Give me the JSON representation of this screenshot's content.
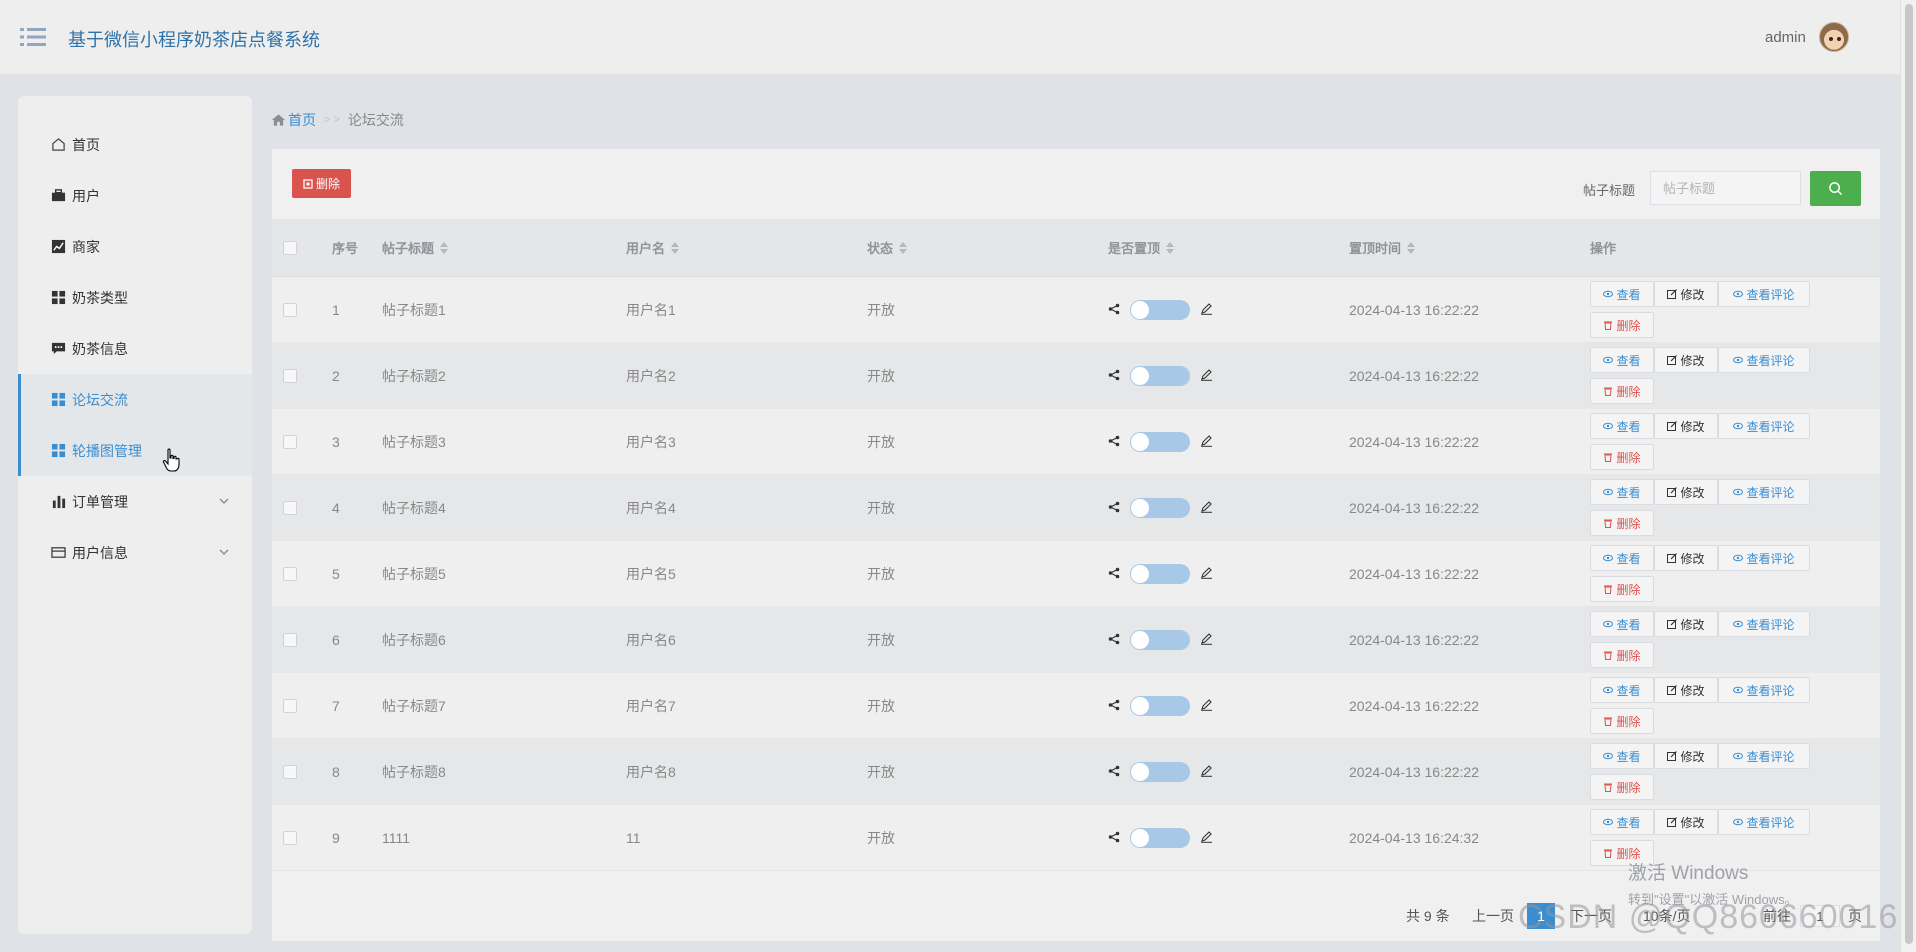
{
  "header": {
    "app_title": "基于微信小程序奶茶店点餐系统",
    "username": "admin"
  },
  "sidebar": {
    "items": [
      {
        "label": "首页",
        "icon": "home-icon"
      },
      {
        "label": "用户",
        "icon": "briefcase-icon"
      },
      {
        "label": "商家",
        "icon": "chart-line-icon"
      },
      {
        "label": "奶茶类型",
        "icon": "grid-icon"
      },
      {
        "label": "奶茶信息",
        "icon": "chat-icon"
      },
      {
        "label": "论坛交流",
        "icon": "grid-icon",
        "active": true
      },
      {
        "label": "轮播图管理",
        "icon": "grid-icon",
        "active": true
      },
      {
        "label": "订单管理",
        "icon": "bar-chart-icon",
        "expandable": true
      },
      {
        "label": "用户信息",
        "icon": "card-icon",
        "expandable": true
      }
    ]
  },
  "breadcrumb": {
    "home": "首页",
    "separator": "> >",
    "current": "论坛交流"
  },
  "toolbar": {
    "delete_label": "删除",
    "search_label": "帖子标题",
    "search_placeholder": "帖子标题"
  },
  "table": {
    "columns": [
      "序号",
      "帖子标题",
      "用户名",
      "状态",
      "是否置顶",
      "置顶时间",
      "操作"
    ],
    "rows": [
      {
        "index": "1",
        "title": "帖子标题1",
        "user": "用户名1",
        "status": "开放",
        "pinned": false,
        "time": "2024-04-13 16:22:22"
      },
      {
        "index": "2",
        "title": "帖子标题2",
        "user": "用户名2",
        "status": "开放",
        "pinned": false,
        "time": "2024-04-13 16:22:22"
      },
      {
        "index": "3",
        "title": "帖子标题3",
        "user": "用户名3",
        "status": "开放",
        "pinned": false,
        "time": "2024-04-13 16:22:22"
      },
      {
        "index": "4",
        "title": "帖子标题4",
        "user": "用户名4",
        "status": "开放",
        "pinned": false,
        "time": "2024-04-13 16:22:22"
      },
      {
        "index": "5",
        "title": "帖子标题5",
        "user": "用户名5",
        "status": "开放",
        "pinned": false,
        "time": "2024-04-13 16:22:22"
      },
      {
        "index": "6",
        "title": "帖子标题6",
        "user": "用户名6",
        "status": "开放",
        "pinned": false,
        "time": "2024-04-13 16:22:22"
      },
      {
        "index": "7",
        "title": "帖子标题7",
        "user": "用户名7",
        "status": "开放",
        "pinned": false,
        "time": "2024-04-13 16:22:22"
      },
      {
        "index": "8",
        "title": "帖子标题8",
        "user": "用户名8",
        "status": "开放",
        "pinned": false,
        "time": "2024-04-13 16:22:22"
      },
      {
        "index": "9",
        "title": "1111",
        "user": "11",
        "status": "开放",
        "pinned": false,
        "time": "2024-04-13 16:24:32"
      }
    ],
    "actions": {
      "view": "查看",
      "edit": "修改",
      "comments": "查看评论",
      "delete": "删除"
    }
  },
  "pagination": {
    "total": "共 9 条",
    "prev": "上一页",
    "current_page": "1",
    "next": "下一页",
    "page_size": "10条/页",
    "goto": "前往",
    "goto_value": "1",
    "page_unit": "页"
  },
  "watermark": {
    "activation_title": "激活 Windows",
    "activation_sub": "转到\"设置\"以激活 Windows。",
    "csdn": "CSDN @QQ860660016"
  },
  "colors": {
    "accent": "#3a8ed0",
    "danger": "#d9534f",
    "success": "#4cae4c",
    "title": "#2f72a9"
  }
}
